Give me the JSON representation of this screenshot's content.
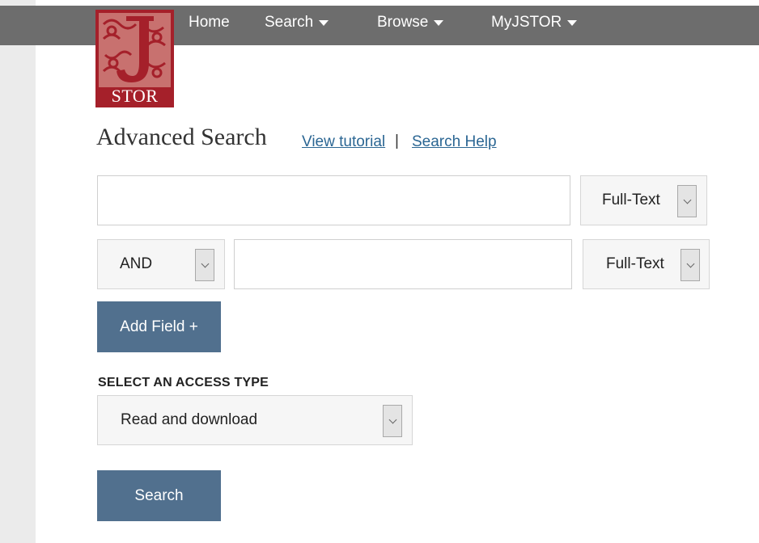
{
  "nav": {
    "items": [
      {
        "label": "Home",
        "dropdown": false
      },
      {
        "label": "Search",
        "dropdown": true
      },
      {
        "label": "Browse",
        "dropdown": true
      },
      {
        "label": "MyJSTOR",
        "dropdown": true
      }
    ]
  },
  "logo": {
    "text": "STOR",
    "letter": "J"
  },
  "header": {
    "title": "Advanced Search",
    "tutorial_link": "View tutorial",
    "separator": "|",
    "help_link": "Search Help"
  },
  "search_rows": [
    {
      "value": "",
      "field": "Full-Text"
    },
    {
      "operator": "AND",
      "value": "",
      "field": "Full-Text"
    }
  ],
  "add_field_label": "Add Field +",
  "access": {
    "label": "SELECT AN ACCESS TYPE",
    "selected": "Read and download"
  },
  "search_button_label": "Search",
  "colors": {
    "top_bar": "#6d6d6d",
    "logo_red": "#a5202a",
    "button": "#51708e",
    "link": "#2b6693"
  }
}
